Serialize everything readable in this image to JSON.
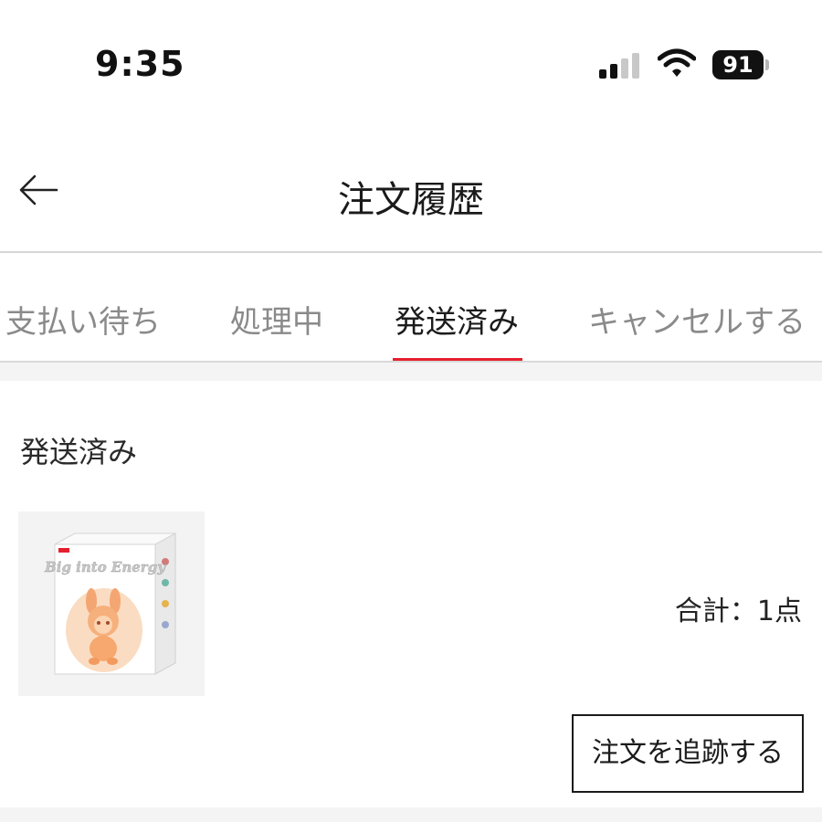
{
  "status_bar": {
    "time": "9:35",
    "battery_level": "91",
    "signal_bars_active": 2,
    "signal_bars_total": 4
  },
  "header": {
    "back_icon": "arrow-left-icon",
    "title": "注文履歴"
  },
  "tabs": [
    {
      "label": "支払い待ち",
      "active": false
    },
    {
      "label": "処理中",
      "active": false
    },
    {
      "label": "発送済み",
      "active": true
    },
    {
      "label": "キャンセルする",
      "active": false
    }
  ],
  "order": {
    "status_label": "発送済み",
    "product_box_text": "Big into Energy",
    "total_label": "合計：1点",
    "track_button_label": "注文を追跡する"
  },
  "colors": {
    "accent": "#e5202e",
    "inactive_tab": "#8a8a8a",
    "background_band": "#f4f4f4"
  }
}
